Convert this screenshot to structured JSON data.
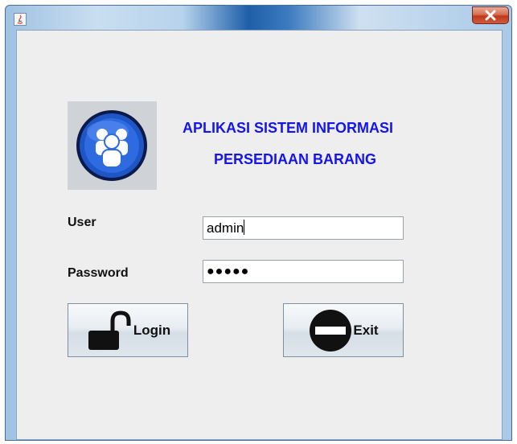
{
  "window": {
    "icon": "java-icon",
    "close_icon": "close-icon"
  },
  "header": {
    "title_line1": "APLIKASI SISTEM INFORMASI",
    "title_line2": "PERSEDIAAN  BARANG",
    "logo_icon": "users-group-icon",
    "title_color": "#1414ee"
  },
  "form": {
    "user_label": "User",
    "user_value": "admin",
    "password_label": "Password",
    "password_value": "●●●●●"
  },
  "buttons": {
    "login_label": "Login",
    "login_icon": "unlocked-padlock-icon",
    "exit_label": "Exit",
    "exit_icon": "no-entry-icon"
  }
}
